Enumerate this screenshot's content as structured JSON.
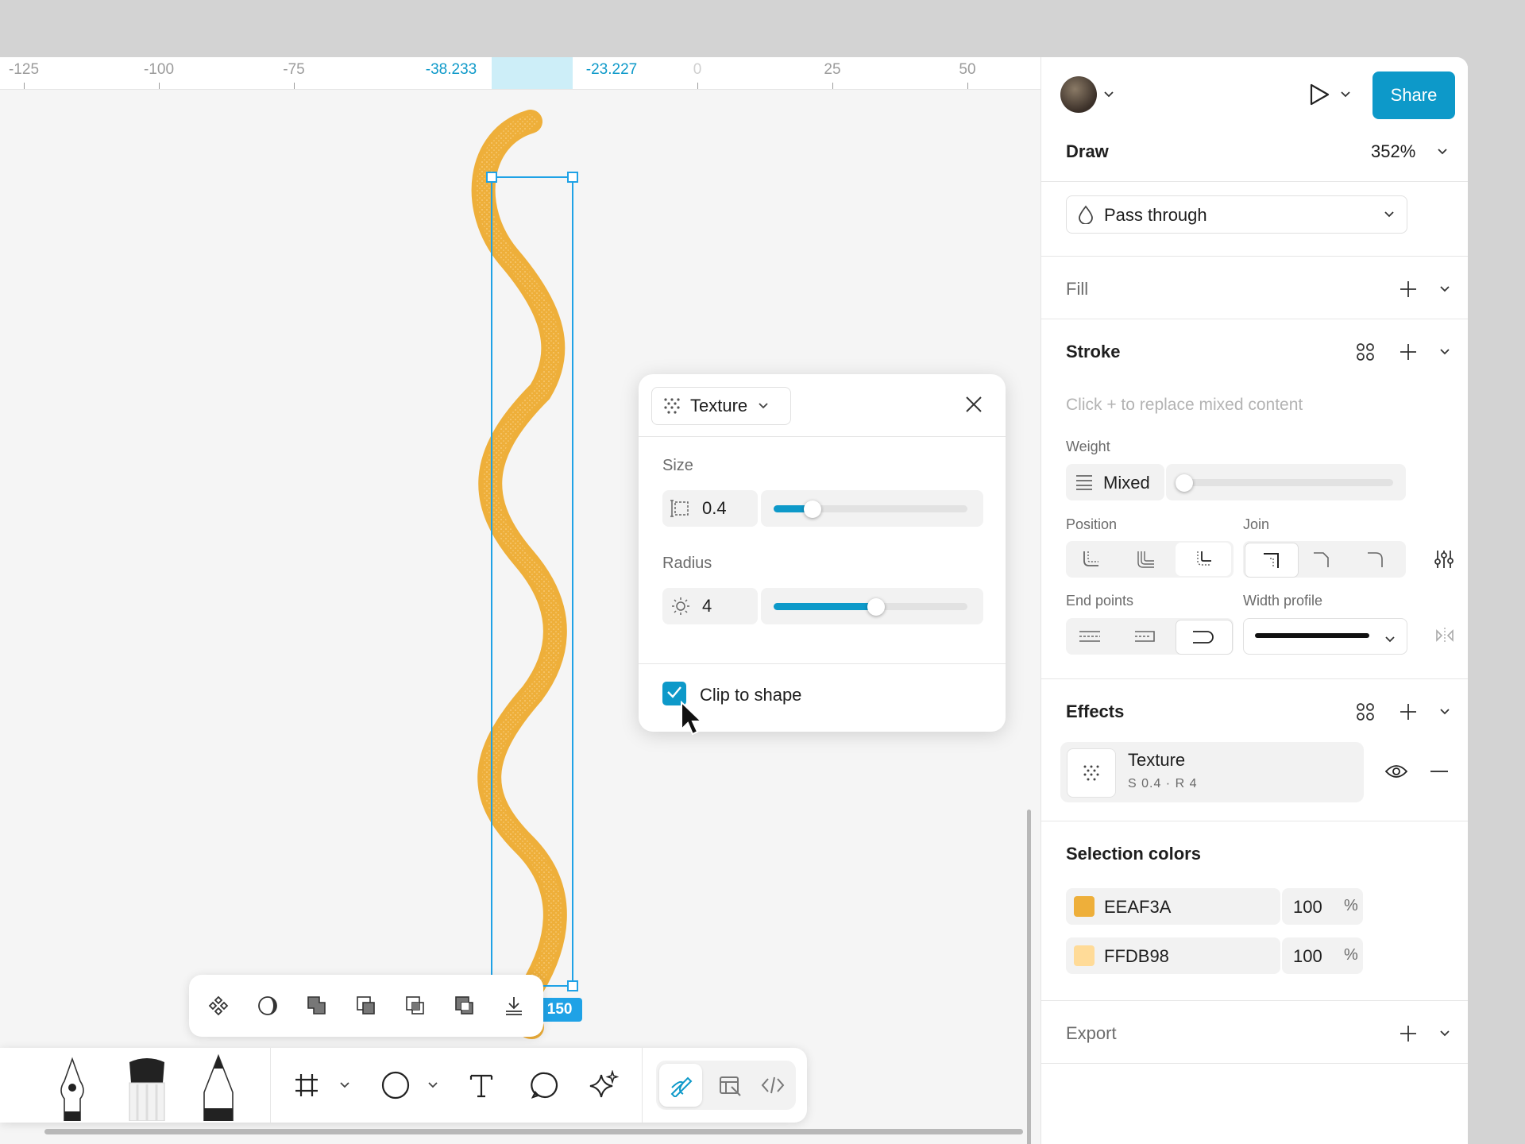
{
  "ruler": {
    "labels": [
      "-125",
      "-100",
      "-75",
      "-38.233",
      "-23.227",
      "0",
      "25",
      "50"
    ]
  },
  "selection": {
    "dimensions": "15.01 × 150"
  },
  "header": {
    "share_label": "Share"
  },
  "draw": {
    "title": "Draw",
    "zoom": "352%"
  },
  "layer": {
    "blend_mode": "Pass through"
  },
  "fill": {
    "title": "Fill"
  },
  "stroke": {
    "title": "Stroke",
    "placeholder": "Click + to replace mixed content",
    "weight_label": "Weight",
    "weight_value": "Mixed",
    "position_label": "Position",
    "join_label": "Join",
    "endpoints_label": "End points",
    "width_profile_label": "Width profile"
  },
  "effects": {
    "title": "Effects",
    "item_name": "Texture",
    "item_detail": "S 0.4 · R 4"
  },
  "selection_colors": {
    "title": "Selection colors",
    "colors": [
      {
        "hex": "EEAF3A",
        "opacity": "100",
        "unit": "%",
        "swatch": "#EEAF3A"
      },
      {
        "hex": "FFDB98",
        "opacity": "100",
        "unit": "%",
        "swatch": "#FFDB98"
      }
    ]
  },
  "export": {
    "title": "Export"
  },
  "texture_popup": {
    "type": "Texture",
    "size_label": "Size",
    "size_value": "0.4",
    "size_fraction": 0.2,
    "radius_label": "Radius",
    "radius_value": "4",
    "radius_fraction": 0.53,
    "clip_label": "Clip to shape",
    "clip_checked": true
  },
  "colors": {
    "accent": "#0d99c9",
    "stroke": "#EEAF3A"
  }
}
